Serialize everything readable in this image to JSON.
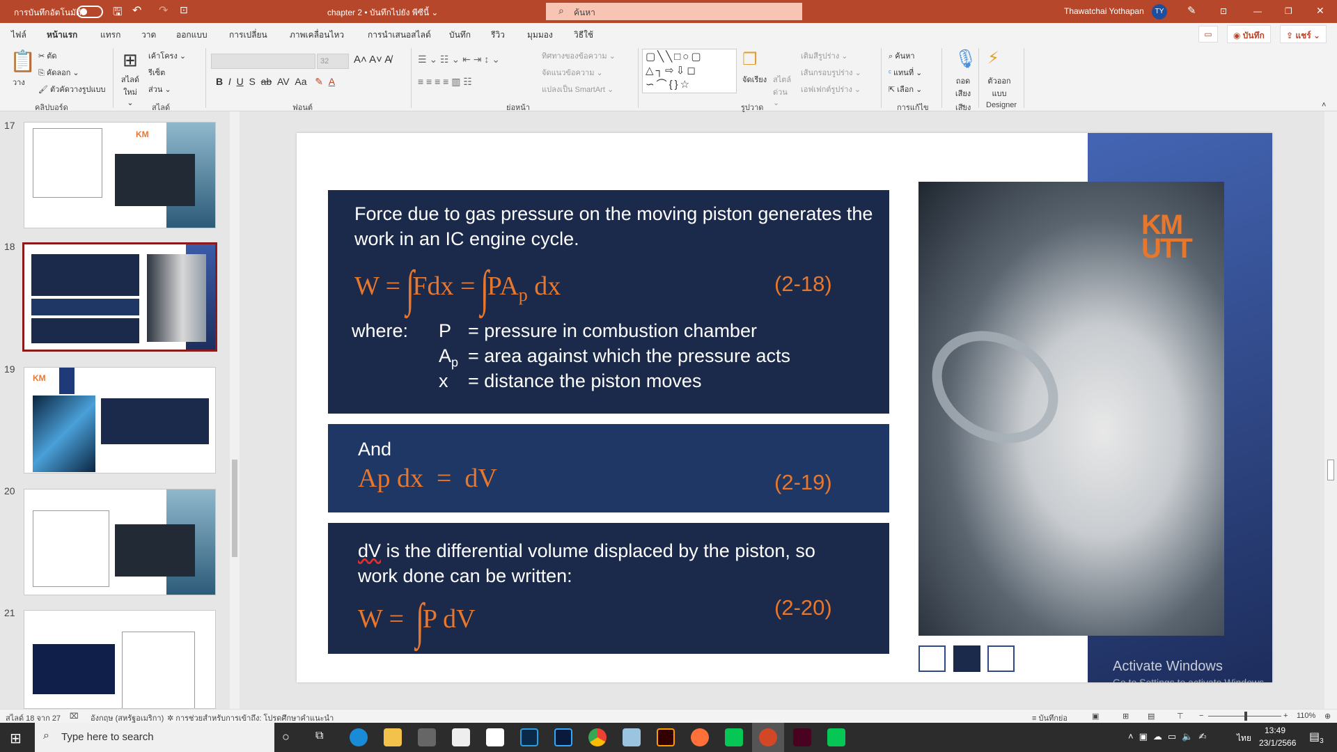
{
  "titlebar": {
    "autosave_label": "การบันทึกอัตโนมัติ",
    "doc_title": "chapter 2 • บันทึกไปยัง พีซีนี้ ⌄",
    "search_placeholder": "ค้นหา",
    "user_name": "Thawatchai Yothapan",
    "user_initials": "TY"
  },
  "tabs": [
    {
      "label": "ไฟล์"
    },
    {
      "label": "หน้าแรก",
      "active": true
    },
    {
      "label": "แทรก"
    },
    {
      "label": "วาด"
    },
    {
      "label": "ออกแบบ"
    },
    {
      "label": "การเปลี่ยน"
    },
    {
      "label": "ภาพเคลื่อนไหว"
    },
    {
      "label": "การนำเสนอสไลด์"
    },
    {
      "label": "บันทึก"
    },
    {
      "label": "รีวิว"
    },
    {
      "label": "มุมมอง"
    },
    {
      "label": "วิธีใช้"
    }
  ],
  "top_buttons": {
    "record": "◉ บันทึก",
    "share": "⇪ แชร์ ⌄"
  },
  "ribbon": {
    "clipboard": {
      "paste": "วาง",
      "cut": "ตัด",
      "copy": "คัดลอก ⌄",
      "format_painter": "ตัวคัดวางรูปแบบ",
      "group": "คลิปบอร์ด"
    },
    "slides": {
      "new_slide": "สไลด์ ใหม่ ⌄",
      "layout": "เค้าโครง ⌄",
      "reset": "รีเซ็ต",
      "section": "ส่วน ⌄",
      "group": "สไลด์"
    },
    "font": {
      "font_size": "32",
      "group": "ฟอนต์"
    },
    "paragraph": {
      "text_direction": "ทิศทางของข้อความ ⌄",
      "align_text": "จัดแนวข้อความ ⌄",
      "smartart": "แปลงเป็น SmartArt ⌄",
      "group": "ย่อหน้า"
    },
    "drawing": {
      "arrange": "จัดเรียง",
      "quick_styles": "สไตล์ ด่วน ⌄",
      "shape_fill": "เติมสีรูปร่าง ⌄",
      "shape_outline": "เส้นกรอบรูปร่าง ⌄",
      "shape_effects": "เอฟเฟกต์รูปร่าง ⌄",
      "group": "รูปวาด"
    },
    "editing": {
      "find": "ค้นหา",
      "replace": "แทนที่ ⌄",
      "select": "เลือก ⌄",
      "group": "การแก้ไข"
    },
    "voice": {
      "dictate": "ถอด เสียง ⌄",
      "group": "เสียง"
    },
    "designer": {
      "design_ideas": "ตัวออก แบบ",
      "group": "Designer"
    }
  },
  "slide_panel": {
    "numbers": [
      "17",
      "18",
      "19",
      "20",
      "21"
    ],
    "selected": "18"
  },
  "slide": {
    "box1": {
      "intro": "Force due to gas pressure on the moving piston generates the",
      "intro2": "work in an IC engine cycle.",
      "eq_w": "W =",
      "eq_fdx": "Fdx =",
      "eq_pa": "PA",
      "eq_sub": "p",
      "eq_dx": " dx",
      "eq_num": "(2-18)",
      "where": "where:",
      "defs": [
        {
          "sym": "P",
          "sub": "",
          "text": "= pressure in combustion chamber"
        },
        {
          "sym": "A",
          "sub": "p",
          "text": "= area against which the pressure acts"
        },
        {
          "sym": "x",
          "sub": "",
          "text": "= distance the piston moves"
        }
      ]
    },
    "box2": {
      "and": "And",
      "eq": "Ap dx  =  dV",
      "eq_num": "(2-19)"
    },
    "box3": {
      "text_dv": "dV",
      "text1": " is the differential volume displaced by the piston, so",
      "text2": "work done can be written:",
      "eq_w": "W =",
      "eq_rest": "P dV",
      "eq_num": "(2-20)"
    },
    "logo": "KMUTT",
    "colors": {
      "box": "#1b2a4a",
      "box_alt": "#1f3764",
      "accent": "#e8772e",
      "band": "#3a5ba8"
    }
  },
  "watermark": {
    "title": "Activate Windows",
    "subtitle": "Go to Settings to activate Windows."
  },
  "status": {
    "slide_of": "สไลด์ 18 จาก 27",
    "language": "อังกฤษ (สหรัฐอเมริกา)",
    "accessibility": "การช่วยสำหรับการเข้าถึง: โปรดศึกษาคำแนะนำ",
    "notes": "บันทึกย่อ",
    "zoom": "110%",
    "zoom_percent": 110
  },
  "taskbar": {
    "search_placeholder": "Type here to search",
    "time": "13:49",
    "date": "23/1/2566",
    "lang": "ไทย",
    "notifications": "3"
  }
}
